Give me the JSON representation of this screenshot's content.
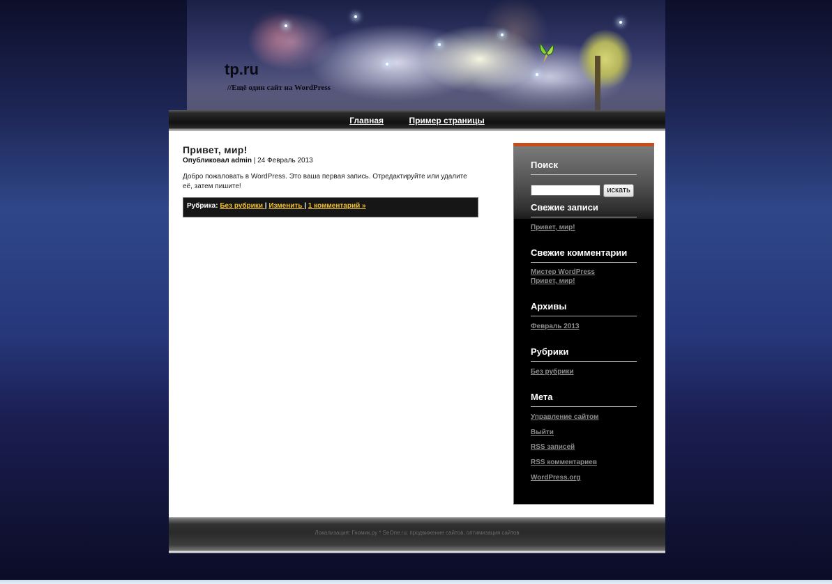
{
  "site": {
    "title": "tp.ru",
    "description": "//Ещё один сайт на WordPress"
  },
  "nav": {
    "items": [
      "Главная",
      "Пример страницы"
    ]
  },
  "post": {
    "title": "Привет, мир!",
    "meta_prefix": "Опубликовал",
    "author": "admin",
    "date": "24 Февраль 2013",
    "body": "Добро пожаловать в WordPress. Это ваша первая запись. Отредактируйте или удалите её, затем пишите!",
    "footer_label": "Рубрика:",
    "category": "Без рубрики",
    "edit": "Изменить",
    "comments": "1 комментарий »",
    "separator": "|"
  },
  "sidebar": {
    "search_title": "Поиск",
    "search_button": "искать",
    "recent_posts_title": "Свежие записи",
    "recent_posts": [
      "Привет, мир!"
    ],
    "recent_comments_title": "Свежие комментарии",
    "recent_comments": [
      "Мистер WordPress",
      "Привет, мир!"
    ],
    "archives_title": "Архивы",
    "archives": [
      "Февраль 2013"
    ],
    "categories_title": "Рубрики",
    "categories": [
      "Без рубрики"
    ],
    "meta_title": "Мета",
    "meta": [
      "Управление сайтом",
      "Выйти",
      "RSS записей",
      "RSS комментариев",
      "WordPress.org"
    ]
  },
  "footer": {
    "text": "Локализация:  Гномик.ру  *  SeOne.ru: продвижение сайтов,  оптимизация сайтов"
  },
  "colors": {
    "accent": "#c84c1a",
    "link_yellow": "#f0c030",
    "sidebar_link": "#8c8c8c"
  }
}
